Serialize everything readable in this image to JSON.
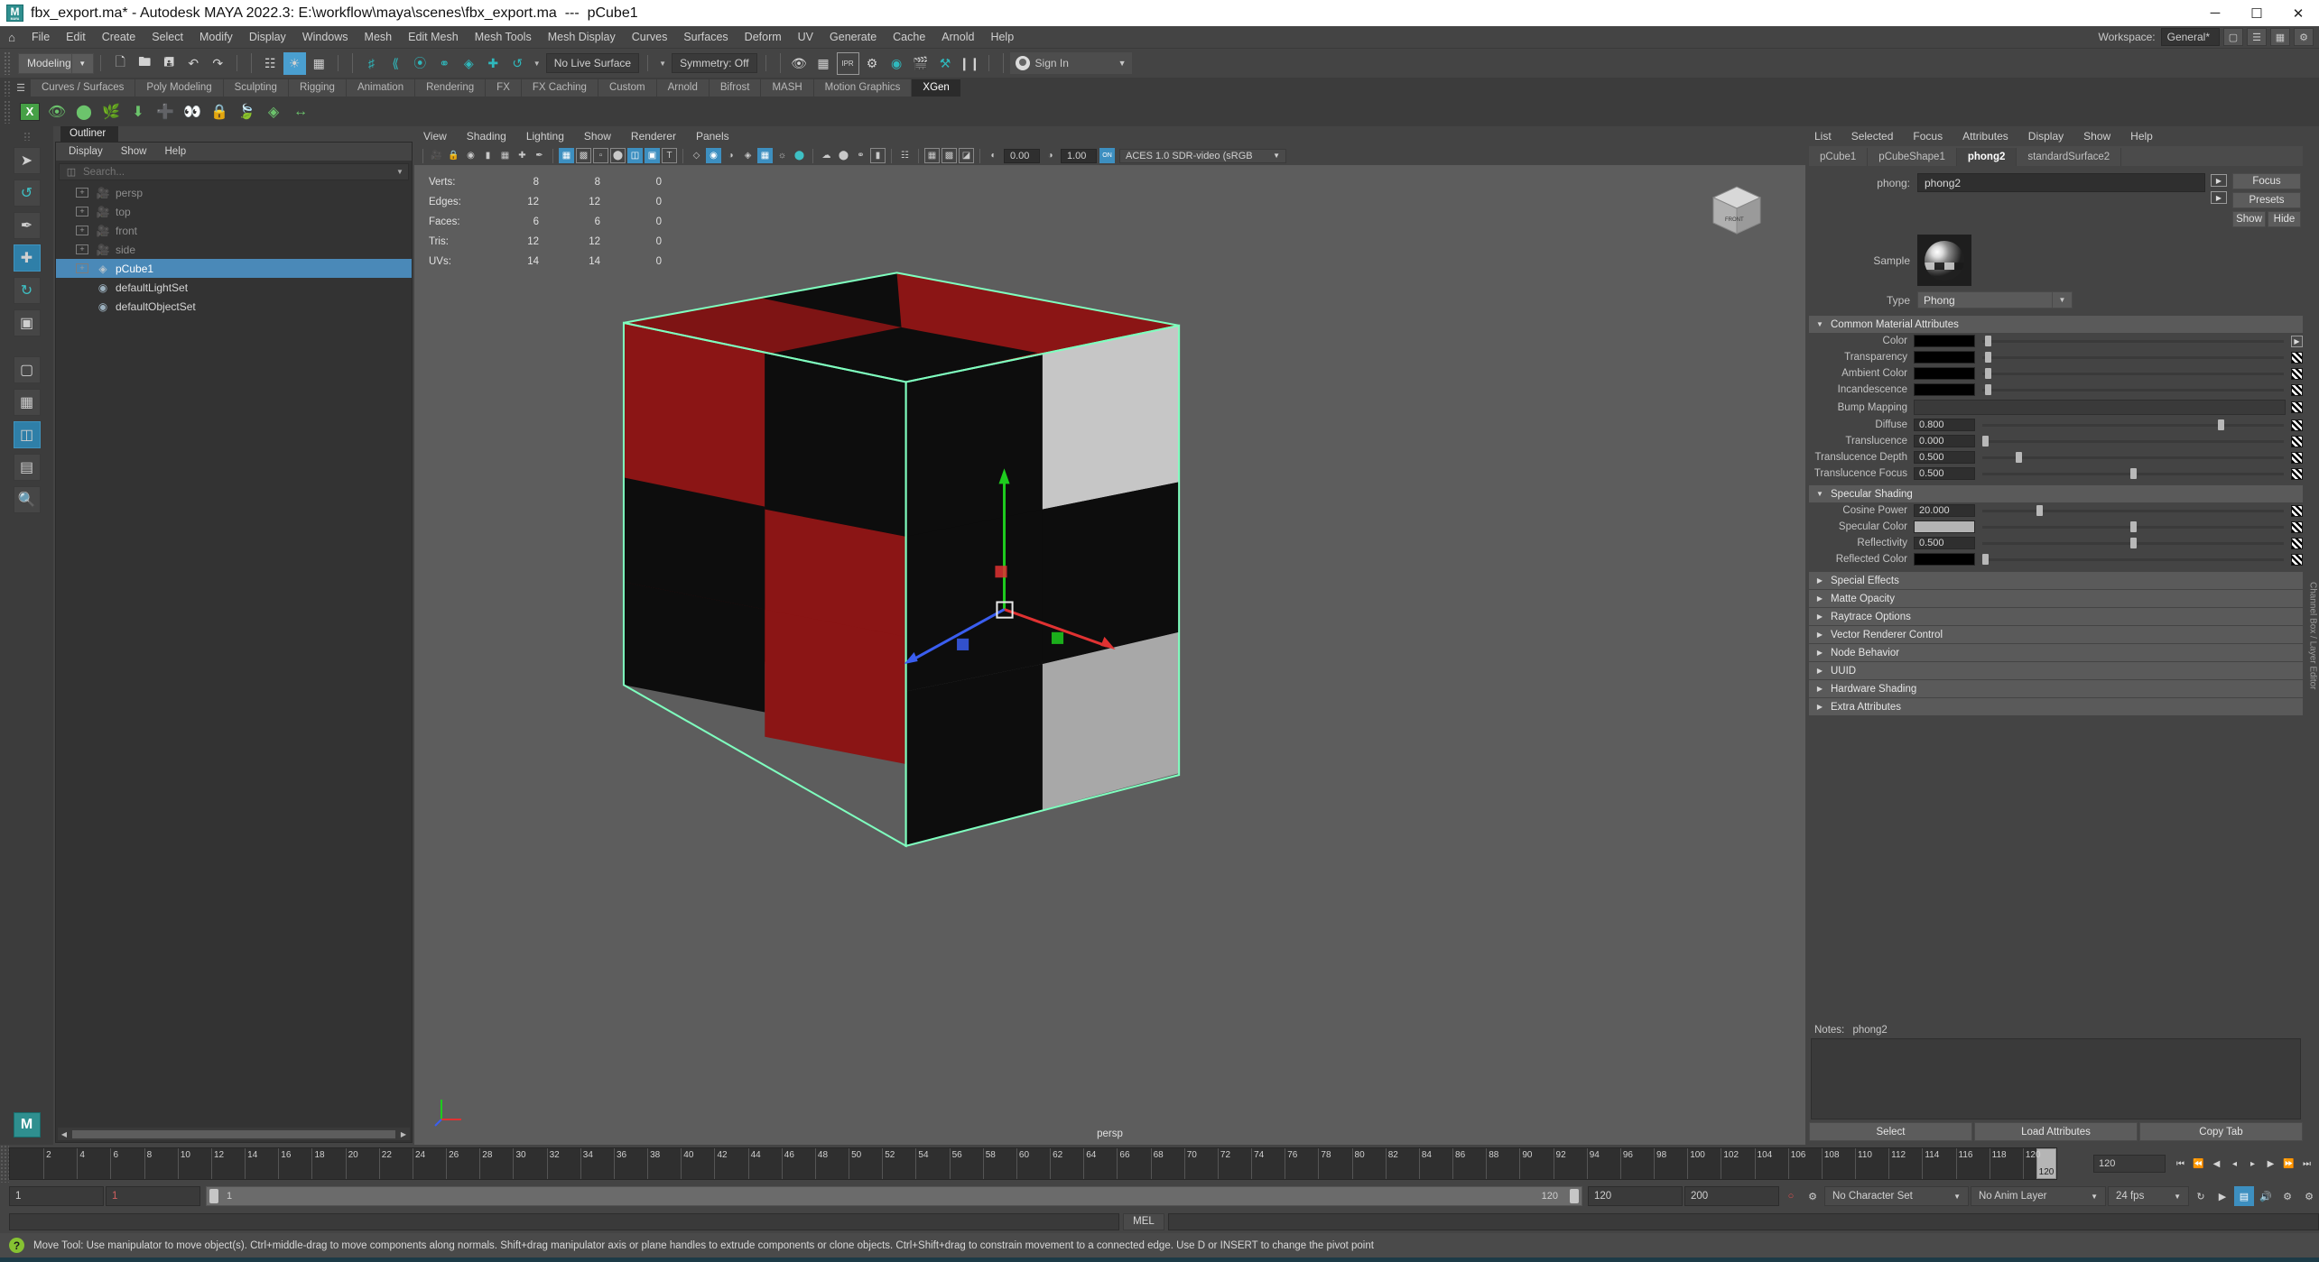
{
  "window": {
    "title": "fbx_export.ma* - Autodesk MAYA 2022.3: E:\\workflow\\maya\\scenes\\fbx_export.ma  ---  pCube1",
    "minimize": "─",
    "maximize": "☐",
    "close": "✕"
  },
  "menubar": {
    "home_icon": "⌂",
    "items": [
      "File",
      "Edit",
      "Create",
      "Select",
      "Modify",
      "Display",
      "Windows",
      "Mesh",
      "Edit Mesh",
      "Mesh Tools",
      "Mesh Display",
      "Curves",
      "Surfaces",
      "Deform",
      "UV",
      "Generate",
      "Cache",
      "Arnold",
      "Help"
    ],
    "workspace_label": "Workspace:",
    "workspace_value": "General*"
  },
  "toolbar": {
    "menuset": "Modeling",
    "live_surface": "No Live Surface",
    "symmetry": "Symmetry: Off",
    "signin": "Sign In",
    "icons": [
      "new-scene-icon",
      "open-scene-icon",
      "save-scene-icon",
      "undo-icon",
      "redo-icon",
      "select-by-hierarchy-icon",
      "select-by-object-icon",
      "select-by-component-icon",
      "snap-to-grid-icon",
      "snap-to-curve-icon",
      "snap-to-point-icon",
      "snap-to-projected-center-icon",
      "snap-to-view-plane-icon",
      "make-live-icon",
      "render-current-frame-icon",
      "ipr-render-icon",
      "render-settings-icon",
      "hypershade-icon",
      "render-view-icon",
      "render-sequence-icon",
      "clear-graph-icon",
      "pause-icon"
    ]
  },
  "shelf": {
    "tabs": [
      "Curves / Surfaces",
      "Poly Modeling",
      "Sculpting",
      "Rigging",
      "Animation",
      "Rendering",
      "FX",
      "FX Caching",
      "Custom",
      "Arnold",
      "Bifrost",
      "MASH",
      "Motion Graphics",
      "XGen"
    ],
    "active_tab": "XGen",
    "icons": [
      "xgen-editor-icon",
      "preview-visibility-icon",
      "hide-guides-icon",
      "add-guides-icon",
      "import-collection-icon",
      "add-guide-icon",
      "guide-visibility-icon",
      "lock-guide-icon",
      "comb-guides-icon",
      "density-map-icon",
      "length-map-icon"
    ]
  },
  "toolbox": {
    "items": [
      {
        "name": "select-tool",
        "glyph": "➤",
        "active": false
      },
      {
        "name": "lasso-tool",
        "glyph": "☁",
        "active": false
      },
      {
        "name": "paint-select-tool",
        "glyph": "✐",
        "active": false
      },
      {
        "name": "move-tool",
        "glyph": "✛",
        "active": true
      },
      {
        "name": "rotate-tool",
        "glyph": "↺",
        "active": false
      },
      {
        "name": "scale-tool",
        "glyph": "▫",
        "active": false
      },
      {
        "name": "last-tool",
        "glyph": "▦",
        "active": false
      },
      {
        "name": "single-perspective-layout",
        "glyph": "□",
        "active": false
      },
      {
        "name": "four-view-layout",
        "glyph": "⊞",
        "active": false
      },
      {
        "name": "persp-outliner-layout",
        "glyph": "▥",
        "active": true
      },
      {
        "name": "hypershade-layout",
        "glyph": "▨",
        "active": false
      },
      {
        "name": "magnify-layout",
        "glyph": "⌕",
        "active": false
      }
    ]
  },
  "outliner": {
    "tab_title": "Outliner",
    "menu": [
      "Display",
      "Show",
      "Help"
    ],
    "search_placeholder": "Search...",
    "search_value": "",
    "items": [
      {
        "label": "persp",
        "icon": "camera-icon",
        "type": "camera",
        "expandable": true,
        "selected": false
      },
      {
        "label": "top",
        "icon": "camera-icon",
        "type": "camera",
        "expandable": true,
        "selected": false
      },
      {
        "label": "front",
        "icon": "camera-icon",
        "type": "camera",
        "expandable": true,
        "selected": false
      },
      {
        "label": "side",
        "icon": "camera-icon",
        "type": "camera",
        "expandable": true,
        "selected": false
      },
      {
        "label": "pCube1",
        "icon": "mesh-icon",
        "type": "mesh",
        "expandable": true,
        "selected": true
      },
      {
        "label": "defaultLightSet",
        "icon": "set-icon",
        "type": "set",
        "expandable": false,
        "selected": false
      },
      {
        "label": "defaultObjectSet",
        "icon": "set-icon",
        "type": "set",
        "expandable": false,
        "selected": false
      }
    ]
  },
  "viewport": {
    "menu": [
      "View",
      "Shading",
      "Lighting",
      "Show",
      "Renderer",
      "Panels"
    ],
    "exposure": "0.00",
    "gamma": "1.00",
    "color_space": "ACES 1.0 SDR-video (sRGB",
    "camera_label": "persp",
    "gizmo_label": "FRONT",
    "hud": {
      "columns": 3,
      "rows": [
        {
          "label": "Verts:",
          "values": [
            "8",
            "8",
            "0"
          ]
        },
        {
          "label": "Edges:",
          "values": [
            "12",
            "12",
            "0"
          ]
        },
        {
          "label": "Faces:",
          "values": [
            "6",
            "6",
            "0"
          ]
        },
        {
          "label": "Tris:",
          "values": [
            "12",
            "12",
            "0"
          ]
        },
        {
          "label": "UVs:",
          "values": [
            "14",
            "14",
            "0"
          ]
        }
      ]
    }
  },
  "attribute_editor": {
    "menu": [
      "List",
      "Selected",
      "Focus",
      "Attributes",
      "Display",
      "Show",
      "Help"
    ],
    "tabs": [
      "pCube1",
      "pCubeShape1",
      "phong2",
      "standardSurface2"
    ],
    "active_tab": "phong2",
    "node_label": "phong:",
    "node_name": "phong2",
    "buttons": {
      "focus": "Focus",
      "presets": "Presets",
      "show": "Show",
      "hide": "Hide"
    },
    "sample_label": "Sample",
    "type_label": "Type",
    "type_value": "Phong",
    "sections": [
      {
        "title": "Common Material Attributes",
        "expanded": true,
        "attributes": [
          {
            "label": "Color",
            "kind": "color",
            "color": "#000000",
            "slider": 0.02,
            "map": "checker"
          },
          {
            "label": "Transparency",
            "kind": "color",
            "color": "#000000",
            "slider": 0.02,
            "map": "checker"
          },
          {
            "label": "Ambient Color",
            "kind": "color",
            "color": "#000000",
            "slider": 0.02,
            "map": "checker"
          },
          {
            "label": "Incandescence",
            "kind": "color",
            "color": "#000000",
            "slider": 0.02,
            "map": "checker"
          },
          {
            "label": "Bump Mapping",
            "kind": "bump",
            "map": "checker"
          },
          {
            "label": "Diffuse",
            "kind": "value",
            "value": "0.800",
            "slider": 0.79,
            "map": "checker"
          },
          {
            "label": "Translucence",
            "kind": "value",
            "value": "0.000",
            "slider": 0.01,
            "map": "checker"
          },
          {
            "label": "Translucence Depth",
            "kind": "value",
            "value": "0.500",
            "slider": 0.11,
            "map": "checker"
          },
          {
            "label": "Translucence Focus",
            "kind": "value",
            "value": "0.500",
            "slider": 0.5,
            "map": "checker"
          }
        ]
      },
      {
        "title": "Specular Shading",
        "expanded": true,
        "attributes": [
          {
            "label": "Cosine Power",
            "kind": "value",
            "value": "20.000",
            "slider": 0.19,
            "map": "checker"
          },
          {
            "label": "Specular Color",
            "kind": "color",
            "color": "#b4b4b4",
            "slider": 0.5,
            "map": "checker"
          },
          {
            "label": "Reflectivity",
            "kind": "value",
            "value": "0.500",
            "slider": 0.5,
            "map": "checker"
          },
          {
            "label": "Reflected Color",
            "kind": "color",
            "color": "#000000",
            "slider": 0.01,
            "map": "checker"
          }
        ]
      }
    ],
    "collapsed_sections": [
      "Special Effects",
      "Matte Opacity",
      "Raytrace Options",
      "Vector Renderer Control",
      "Node Behavior",
      "UUID",
      "Hardware Shading",
      "Extra Attributes"
    ],
    "notes_label": "Notes:",
    "notes_value": "phong2",
    "notes_text": "",
    "footer": [
      "Select",
      "Load Attributes",
      "Copy Tab"
    ],
    "side_rail": "Channel Box / Layer Editor"
  },
  "timeline": {
    "ticks": [
      "2",
      "4",
      "6",
      "8",
      "10",
      "12",
      "14",
      "16",
      "18",
      "20",
      "22",
      "24",
      "26",
      "28",
      "30",
      "32",
      "34",
      "36",
      "38",
      "40",
      "42",
      "44",
      "46",
      "48",
      "50",
      "52",
      "54",
      "56",
      "58",
      "60",
      "62",
      "64",
      "66",
      "68",
      "70",
      "72",
      "74",
      "76",
      "78",
      "80",
      "82",
      "84",
      "86",
      "88",
      "90",
      "92",
      "94",
      "96",
      "98",
      "100",
      "102",
      "104",
      "106",
      "108",
      "110",
      "112",
      "114",
      "116",
      "118",
      "120"
    ],
    "current_frame": "120",
    "current_frame_field": "120",
    "playback_icons": [
      "go-to-start-icon",
      "step-back-key-icon",
      "step-back-frame-icon",
      "play-backwards-icon",
      "play-forwards-icon",
      "step-forward-frame-icon",
      "step-forward-key-icon",
      "go-to-end-icon"
    ]
  },
  "rangebar": {
    "start_field": "1",
    "start_field2": "1",
    "range_start": "1",
    "range_end": "120",
    "anim_start": "120",
    "anim_end": "200",
    "character_set": "No Character Set",
    "anim_layer": "No Anim Layer",
    "fps": "24 fps",
    "icons": [
      "auto-key-icon",
      "animation-preferences-icon",
      "playback-options-icon",
      "sound-icon",
      "settings-icon"
    ]
  },
  "commandline": {
    "mel_label": "MEL",
    "input_value": "",
    "output_value": ""
  },
  "helpline": {
    "icon": "help-icon",
    "text": "Move Tool: Use manipulator to move object(s). Ctrl+middle-drag to move components along normals. Shift+drag manipulator axis or plane handles to extrude components or clone objects. Ctrl+Shift+drag to constrain movement to a connected edge. Use D or INSERT to change the pivot point"
  },
  "colors": {
    "accent": "#4a89b8",
    "teal": "#3ec0c4",
    "panel_bg": "#444444",
    "dark_bg": "#2f2f2f",
    "viewport_bg": "#5d5d5d",
    "cube_red": "#8b1a1a",
    "cube_black": "#0d0d0d",
    "cube_white": "#c8c8c8",
    "selection_green": "#7fffbf"
  }
}
